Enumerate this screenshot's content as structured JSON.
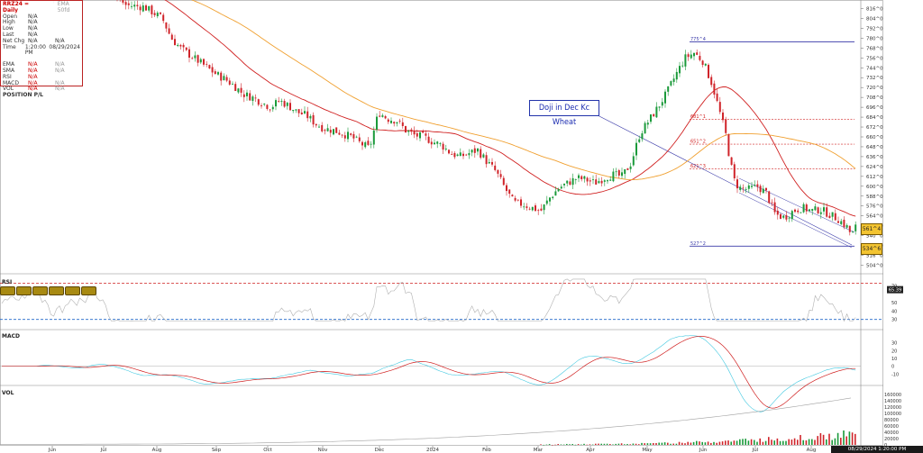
{
  "infobox": {
    "symbol": "RRZ24 = Daily",
    "overlay_note": "EMA 50fd",
    "rows": [
      {
        "k": "Open",
        "v": "N/A"
      },
      {
        "k": "High",
        "v": "N/A"
      },
      {
        "k": "Low",
        "v": "N/A"
      },
      {
        "k": "Last",
        "v": "N/A"
      },
      {
        "k": "Net Chg",
        "v": "N/A",
        "v2": "N/A"
      },
      {
        "k": "Time",
        "v": "1:20:00 PM",
        "v2": "08/29/2024"
      }
    ],
    "ind_rows": [
      {
        "k": "EMA",
        "v": "N/A",
        "v2": "N/A"
      },
      {
        "k": "SMA",
        "v": "N/A",
        "v2": "N/A"
      },
      {
        "k": "RSI",
        "v": "N/A"
      },
      {
        "k": "MACD",
        "v": "N/A",
        "v2": "N/A"
      },
      {
        "k": "VOL",
        "v": "N/A",
        "v2": "N/A"
      }
    ],
    "position": "POSITION P/L"
  },
  "annotation": "Doji in Dec Kc Wheat",
  "price_labels": {
    "high": "775^4",
    "low": "527^2",
    "fib1": "681^1",
    "fib2": "651^2",
    "fib3": "621^3"
  },
  "price_tags": {
    "upper": "561^4",
    "lower": "534^6"
  },
  "panels": {
    "rsi": "RSI",
    "macd": "MACD",
    "vol": "VOL",
    "rsi_value": "65.39"
  },
  "datebox": "08/29/2024 1:20:00 PM",
  "colors": {
    "up": "#1a9a3a",
    "down": "#d0242a",
    "ema": "#d02020",
    "sma": "#f0a030",
    "trend": "#3a3aa8",
    "rsi": "#b0b0b0"
  },
  "chart_data": {
    "type": "candlestick",
    "x_tick_labels": [
      "Jun",
      "Jul",
      "Aug",
      "Sep",
      "Oct",
      "Nov",
      "Dec",
      "2024",
      "Feb",
      "Mar",
      "Apr",
      "May",
      "Jun",
      "Jul",
      "Aug"
    ],
    "y_tick_labels": [
      "504^0",
      "516^0",
      "528^0",
      "540^0",
      "552^0",
      "564^0",
      "576^0",
      "588^0",
      "600^0",
      "612^0",
      "624^0",
      "636^0",
      "648^0",
      "660^0",
      "672^0",
      "684^0",
      "696^0",
      "708^0",
      "720^0",
      "732^0",
      "744^0",
      "756^0",
      "768^0",
      "780^0",
      "792^0",
      "804^0",
      "816^0"
    ],
    "ylim": [
      498,
      822
    ],
    "rsi_ticks": [
      "70",
      "50",
      "40",
      "30"
    ],
    "rsi_levels": [
      73,
      30
    ],
    "macd_ticks": [
      "30",
      "20",
      "10",
      "0",
      "-10"
    ],
    "vol_ticks": [
      "160000",
      "140000",
      "120000",
      "100000",
      "80000",
      "60000",
      "40000",
      "20000",
      "0"
    ],
    "close_path": [
      [
        0,
        840
      ],
      [
        20,
        850
      ],
      [
        40,
        858
      ],
      [
        60,
        830
      ],
      [
        80,
        860
      ],
      [
        100,
        848
      ],
      [
        120,
        840
      ],
      [
        140,
        820
      ],
      [
        160,
        818
      ],
      [
        180,
        804
      ],
      [
        190,
        780
      ],
      [
        200,
        768
      ],
      [
        210,
        760
      ],
      [
        220,
        752
      ],
      [
        230,
        744
      ],
      [
        240,
        736
      ],
      [
        250,
        730
      ],
      [
        260,
        722
      ],
      [
        270,
        712
      ],
      [
        280,
        708
      ],
      [
        290,
        702
      ],
      [
        300,
        696
      ],
      [
        310,
        704
      ],
      [
        320,
        698
      ],
      [
        330,
        690
      ],
      [
        340,
        686
      ],
      [
        350,
        676
      ],
      [
        360,
        670
      ],
      [
        370,
        668
      ],
      [
        380,
        664
      ],
      [
        390,
        660
      ],
      [
        400,
        652
      ],
      [
        410,
        646
      ],
      [
        420,
        690
      ],
      [
        430,
        682
      ],
      [
        440,
        680
      ],
      [
        450,
        668
      ],
      [
        460,
        662
      ],
      [
        470,
        660
      ],
      [
        480,
        654
      ],
      [
        490,
        650
      ],
      [
        500,
        640
      ],
      [
        510,
        636
      ],
      [
        520,
        640
      ],
      [
        530,
        644
      ],
      [
        540,
        630
      ],
      [
        550,
        618
      ],
      [
        560,
        598
      ],
      [
        570,
        580
      ],
      [
        580,
        578
      ],
      [
        590,
        574
      ],
      [
        600,
        570
      ],
      [
        610,
        586
      ],
      [
        620,
        598
      ],
      [
        630,
        604
      ],
      [
        640,
        610
      ],
      [
        650,
        608
      ],
      [
        660,
        604
      ],
      [
        670,
        610
      ],
      [
        680,
        614
      ],
      [
        690,
        612
      ],
      [
        700,
        628
      ],
      [
        710,
        664
      ],
      [
        720,
        680
      ],
      [
        730,
        696
      ],
      [
        740,
        714
      ],
      [
        750,
        736
      ],
      [
        760,
        756
      ],
      [
        770,
        762
      ],
      [
        780,
        752
      ],
      [
        790,
        724
      ],
      [
        800,
        684
      ],
      [
        805,
        664
      ],
      [
        810,
        630
      ],
      [
        815,
        606
      ],
      [
        820,
        598
      ],
      [
        830,
        596
      ],
      [
        840,
        600
      ],
      [
        850,
        592
      ],
      [
        860,
        566
      ],
      [
        870,
        562
      ],
      [
        880,
        570
      ],
      [
        890,
        574
      ],
      [
        900,
        570
      ],
      [
        910,
        572
      ],
      [
        920,
        566
      ],
      [
        930,
        560
      ],
      [
        940,
        550
      ],
      [
        945,
        540
      ],
      [
        950,
        552
      ]
    ]
  }
}
